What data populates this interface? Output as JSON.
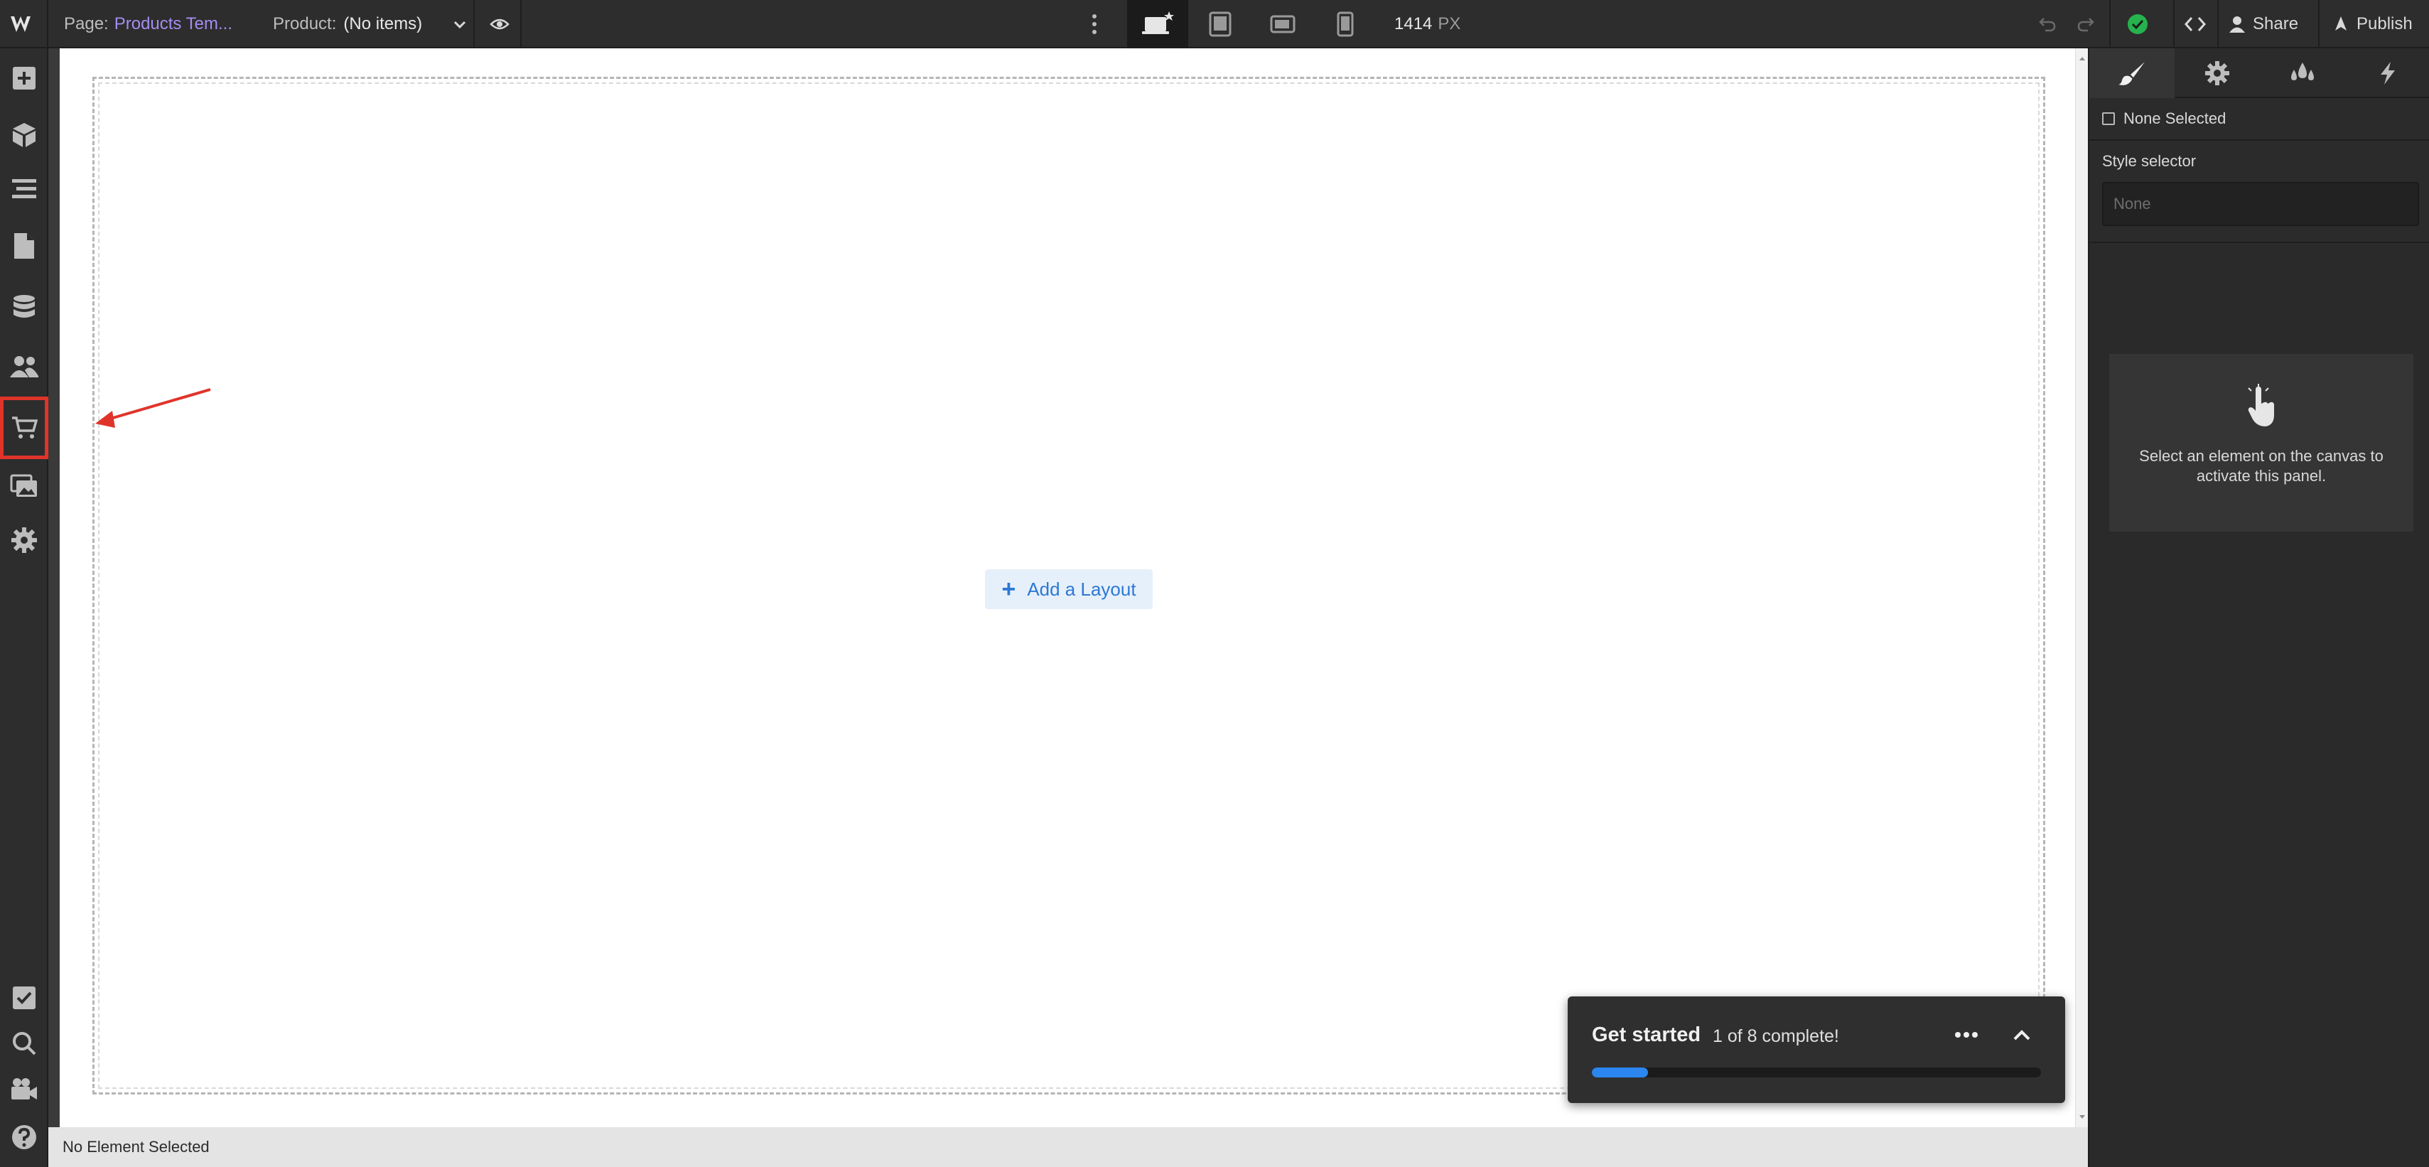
{
  "topbar": {
    "page_label": "Page:",
    "page_name": "Products Tem...",
    "product_label": "Product:",
    "product_value": "(No items)",
    "width_value": "1414",
    "width_unit": "PX",
    "share_label": "Share",
    "publish_label": "Publish",
    "page_name_color": "#a48cf0",
    "status_color": "#26b24d"
  },
  "leftbar": {
    "items": [
      "add-icon",
      "components-icon",
      "navigator-icon",
      "pages-icon",
      "cms-icon",
      "users-icon",
      "ecommerce-cart-icon",
      "assets-icon",
      "settings-icon"
    ],
    "bottom_items": [
      "tasks-icon",
      "search-icon",
      "video-icon",
      "help-icon"
    ],
    "highlight_color": "#e0342a"
  },
  "canvas": {
    "add_layout_plus": "+",
    "add_layout_label": "Add a Layout"
  },
  "statusbar": {
    "text": "No Element Selected"
  },
  "rightpanel": {
    "tabs": [
      "style-brush-icon",
      "settings-gear-icon",
      "style-manager-drops-icon",
      "interactions-lightning-icon"
    ],
    "none_selected": "None Selected",
    "style_selector_label": "Style selector",
    "style_selector_placeholder": "None",
    "hint_text": "Select an element on the canvas to activate this panel."
  },
  "get_started": {
    "title": "Get started",
    "count": "1 of 8 complete!",
    "progress": 0.125,
    "accent": "#2b86f0"
  }
}
